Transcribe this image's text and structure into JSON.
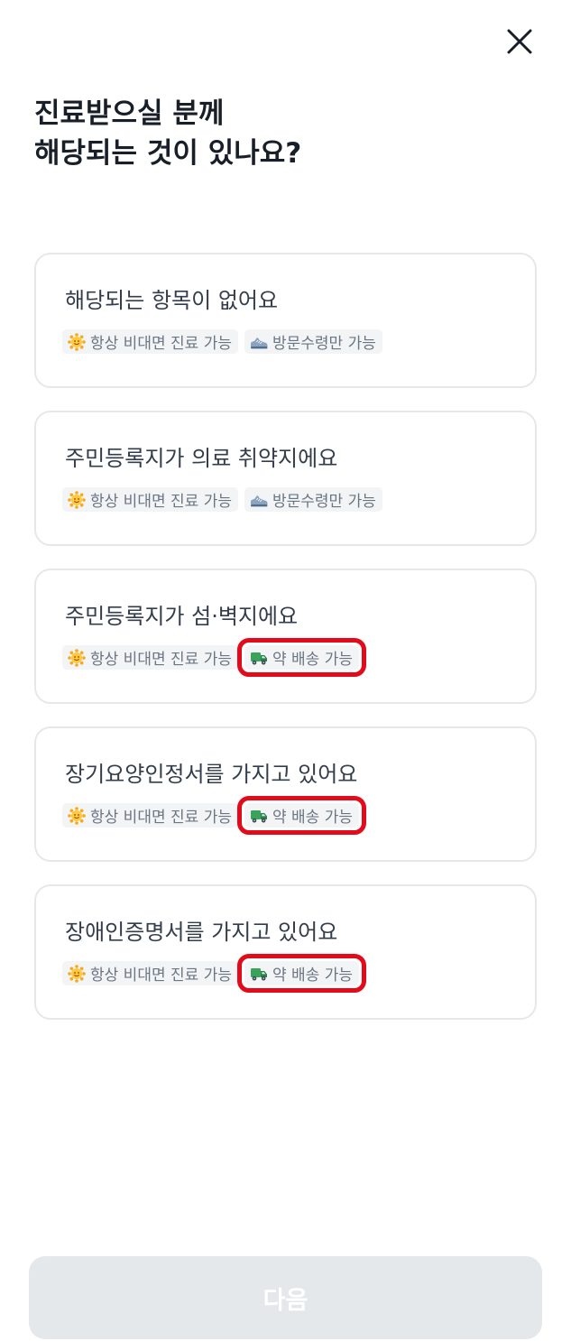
{
  "header": {
    "title_line1": "진료받으실 분께",
    "title_line2": "해당되는 것이 있나요?"
  },
  "options": [
    {
      "label": "해당되는 항목이 없어요",
      "tags": [
        {
          "icon": "sun-icon",
          "label": "항상 비대면 진료 가능",
          "highlighted": false
        },
        {
          "icon": "shoe-icon",
          "label": "방문수령만 가능",
          "highlighted": false
        }
      ]
    },
    {
      "label": "주민등록지가 의료 취약지에요",
      "tags": [
        {
          "icon": "sun-icon",
          "label": "항상 비대면 진료 가능",
          "highlighted": false
        },
        {
          "icon": "shoe-icon",
          "label": "방문수령만 가능",
          "highlighted": false
        }
      ]
    },
    {
      "label": "주민등록지가 섬·벽지에요",
      "tags": [
        {
          "icon": "sun-icon",
          "label": "항상 비대면 진료 가능",
          "highlighted": false
        },
        {
          "icon": "truck-icon",
          "label": "약 배송 가능",
          "highlighted": true
        }
      ]
    },
    {
      "label": "장기요양인정서를 가지고 있어요",
      "tags": [
        {
          "icon": "sun-icon",
          "label": "항상 비대면 진료 가능",
          "highlighted": false
        },
        {
          "icon": "truck-icon",
          "label": "약 배송 가능",
          "highlighted": true
        }
      ]
    },
    {
      "label": "장애인증명서를 가지고 있어요",
      "tags": [
        {
          "icon": "sun-icon",
          "label": "항상 비대면 진료 가능",
          "highlighted": false
        },
        {
          "icon": "truck-icon",
          "label": "약 배송 가능",
          "highlighted": true
        }
      ]
    }
  ],
  "footer": {
    "next_label": "다음"
  },
  "colors": {
    "title_text": "#191f28",
    "option_text": "#333d4b",
    "tag_text": "#6b7684",
    "tag_background": "#f2f4f6",
    "card_border": "#e5e8eb",
    "highlight_outline": "#e30b1a",
    "button_disabled": "#e5e8eb"
  }
}
